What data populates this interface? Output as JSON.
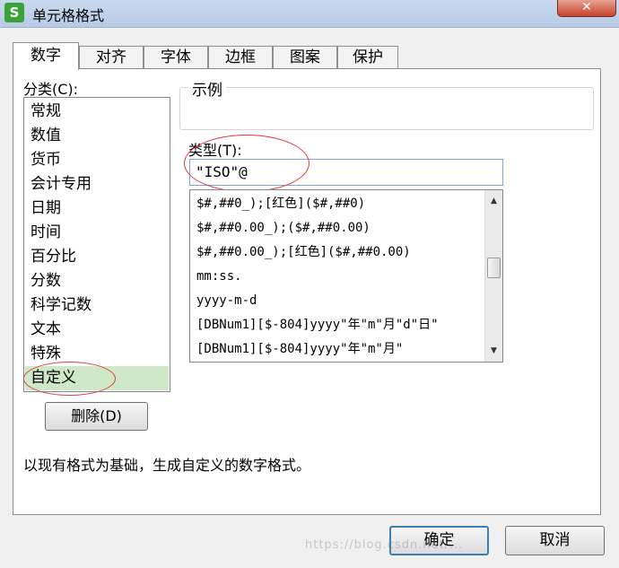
{
  "window": {
    "title": "单元格格式",
    "app_icon_letter": "S",
    "close_label": "✕"
  },
  "tabs": [
    {
      "label": "数字",
      "active": true
    },
    {
      "label": "对齐",
      "active": false
    },
    {
      "label": "字体",
      "active": false
    },
    {
      "label": "边框",
      "active": false
    },
    {
      "label": "图案",
      "active": false
    },
    {
      "label": "保护",
      "active": false
    }
  ],
  "category": {
    "label": "分类(C):",
    "items": [
      "常规",
      "数值",
      "货币",
      "会计专用",
      "日期",
      "时间",
      "百分比",
      "分数",
      "科学记数",
      "文本",
      "特殊",
      "自定义"
    ],
    "selected": "自定义"
  },
  "delete_button": "删除(D)",
  "sample": {
    "label": "示例"
  },
  "type": {
    "label": "类型(T):",
    "value": "\"ISO\"@",
    "list": [
      "$#,##0_);[红色]($#,##0)",
      "$#,##0.00_);($#,##0.00)",
      "$#,##0.00_);[红色]($#,##0.00)",
      "mm:ss.",
      "yyyy-m-d",
      "[DBNum1][$-804]yyyy\"年\"m\"月\"d\"日\"",
      "[DBNum1][$-804]yyyy\"年\"m\"月\""
    ]
  },
  "description": "以现有格式为基础，生成自定义的数字格式。",
  "buttons": {
    "ok": "确定",
    "cancel": "取消"
  },
  "watermark": "https://blog.csdn.net/..."
}
